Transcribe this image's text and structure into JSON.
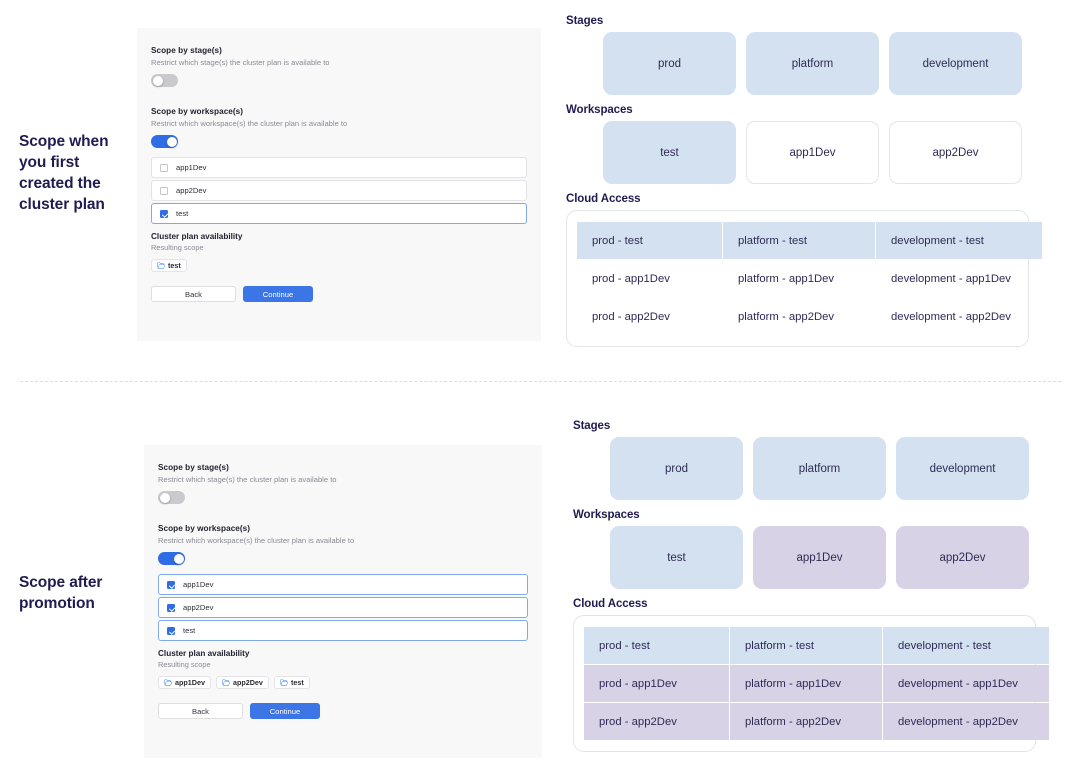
{
  "labels": {
    "top": "Scope when you first created the cluster plan",
    "bottom": "Scope after promotion"
  },
  "colors": {
    "blue_fill": "#d4e1f0",
    "purple_fill": "#d7d2e5",
    "accent": "#3b75e6",
    "navy_text": "#201b50",
    "panel_bg": "#f8f8f8"
  },
  "form": {
    "stage_title": "Scope by stage(s)",
    "stage_sub": "Restrict which stage(s) the cluster plan is available to",
    "workspace_title": "Scope by workspace(s)",
    "workspace_sub": "Restrict which workspace(s) the cluster plan is available to",
    "availability_title": "Cluster plan availability",
    "availability_sub": "Resulting scope",
    "back_label": "Back",
    "continue_label": "Continue",
    "stage_toggle_state": "off",
    "workspace_toggle_state": "on"
  },
  "panel_top": {
    "checkboxes": [
      {
        "label": "app1Dev",
        "checked": false,
        "focused": false
      },
      {
        "label": "app2Dev",
        "checked": false,
        "focused": false
      },
      {
        "label": "test",
        "checked": true,
        "focused": true
      }
    ],
    "chips": [
      "test"
    ]
  },
  "panel_bottom": {
    "checkboxes": [
      {
        "label": "app1Dev",
        "checked": true,
        "focused": true
      },
      {
        "label": "app2Dev",
        "checked": true,
        "focused": true
      },
      {
        "label": "test",
        "checked": true,
        "focused": true
      }
    ],
    "chips": [
      "app1Dev",
      "app2Dev",
      "test"
    ]
  },
  "diagram_top": {
    "stages_heading": "Stages",
    "workspaces_heading": "Workspaces",
    "access_heading": "Cloud Access",
    "stages": [
      {
        "label": "prod",
        "fill": "blue"
      },
      {
        "label": "platform",
        "fill": "blue"
      },
      {
        "label": "development",
        "fill": "blue"
      }
    ],
    "workspaces": [
      {
        "label": "test",
        "fill": "blue"
      },
      {
        "label": "app1Dev",
        "fill": "plain"
      },
      {
        "label": "app2Dev",
        "fill": "plain"
      }
    ],
    "access_rows": [
      [
        {
          "label": "prod - test",
          "fill": "blue"
        },
        {
          "label": "platform - test",
          "fill": "blue"
        },
        {
          "label": "development - test",
          "fill": "blue"
        }
      ],
      [
        {
          "label": "prod - app1Dev",
          "fill": "none"
        },
        {
          "label": "platform - app1Dev",
          "fill": "none"
        },
        {
          "label": "development - app1Dev",
          "fill": "none"
        }
      ],
      [
        {
          "label": "prod - app2Dev",
          "fill": "none"
        },
        {
          "label": "platform - app2Dev",
          "fill": "none"
        },
        {
          "label": "development - app2Dev",
          "fill": "none"
        }
      ]
    ]
  },
  "diagram_bottom": {
    "stages_heading": "Stages",
    "workspaces_heading": "Workspaces",
    "access_heading": "Cloud Access",
    "stages": [
      {
        "label": "prod",
        "fill": "blue"
      },
      {
        "label": "platform",
        "fill": "blue"
      },
      {
        "label": "development",
        "fill": "blue"
      }
    ],
    "workspaces": [
      {
        "label": "test",
        "fill": "blue"
      },
      {
        "label": "app1Dev",
        "fill": "purple"
      },
      {
        "label": "app2Dev",
        "fill": "purple"
      }
    ],
    "access_rows": [
      [
        {
          "label": "prod - test",
          "fill": "blue"
        },
        {
          "label": "platform - test",
          "fill": "blue"
        },
        {
          "label": "development - test",
          "fill": "blue"
        }
      ],
      [
        {
          "label": "prod - app1Dev",
          "fill": "purple"
        },
        {
          "label": "platform - app1Dev",
          "fill": "purple"
        },
        {
          "label": "development - app1Dev",
          "fill": "purple"
        }
      ],
      [
        {
          "label": "prod - app2Dev",
          "fill": "purple"
        },
        {
          "label": "platform - app2Dev",
          "fill": "purple"
        },
        {
          "label": "development - app2Dev",
          "fill": "purple"
        }
      ]
    ]
  },
  "icons": {
    "folder": "folder-icon",
    "checkmark": "check-icon"
  }
}
